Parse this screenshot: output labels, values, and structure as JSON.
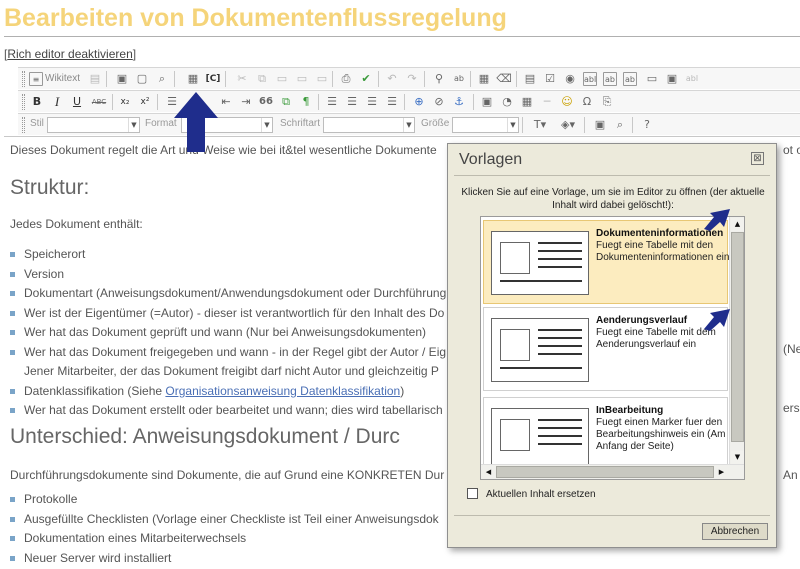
{
  "page": {
    "title": "Bearbeiten von Dokumentenflussregelung",
    "rich_editor_link_open": "[",
    "rich_editor_link": "Rich editor deaktivieren",
    "rich_editor_link_close": "]"
  },
  "toolbar": {
    "wikitext": "Wikitext",
    "style_label": "Stil",
    "format_label": "Format",
    "font_label": "Schriftart",
    "size_label": "Größe",
    "bold": "B",
    "italic": "I",
    "underline": "U",
    "strike": "ABC",
    "subscript": "x₂",
    "superscript": "x²",
    "quote": "66",
    "icons": [
      "source-icon",
      "templates-icon",
      "save-icon",
      "new-page-icon",
      "preview-icon",
      "cut-icon",
      "copy-icon",
      "paste-icon",
      "print-icon",
      "spellcheck-icon",
      "undo-icon",
      "redo-icon",
      "find-icon",
      "replace-icon",
      "table-icon",
      "smiley-icon",
      "anchor-icon",
      "image-icon",
      "link-icon",
      "help-icon"
    ]
  },
  "content": {
    "intro": "Dieses Dokument regelt die Art und Weise wie bei it&tel wesentliche Dokumente",
    "intro_tail": "ot o",
    "heading1": "Struktur:",
    "lead1": "Jedes Dokument enthält:",
    "list1": [
      "Speicherort",
      "Version",
      "Dokumentart (Anweisungsdokument/Anwendungsdokument oder Durchführung",
      "Wer ist der Eigentümer (=Autor) - dieser ist verantwortlich für den Inhalt des Do",
      "Wer hat das Dokument geprüft und wann (Nur bei Anweisungsdokumenten)",
      "Wer hat das Dokument freigegeben und wann - in der Regel gibt der Autor / Eig"
    ],
    "list1_cont": "Jener Mitarbeiter, der das Dokument freigibt darf nicht Autor und gleichzeitig P",
    "list1_klass_prefix": "Datenklassifikation (Siehe ",
    "list1_klass_link": "Organisationsanweisung Datenklassifikation",
    "list1_klass_suffix": ")",
    "list1_last": "Wer hat das Dokument erstellt oder bearbeitet und wann; dies wird tabellarisch",
    "right_frag_1": "(Ne",
    "right_frag_2": "ers u",
    "heading2": "Unterschied: Anweisungsdokument / Durc",
    "lead2": "Durchführungsdokumente sind Dokumente, die auf Grund eine KONKRETEN Dur",
    "lead2_tail": "An",
    "list2": [
      "Protokolle",
      "Ausgefüllte Checklisten (Vorlage einer Checkliste ist Teil einer Anweisungsdok",
      "Dokumentation eines Mitarbeiterwechsels",
      "Neuer Server wird installiert"
    ]
  },
  "dialog": {
    "title": "Vorlagen",
    "close": "⊠",
    "description": "Klicken Sie auf eine Vorlage, um sie im Editor zu öffnen (der aktuelle Inhalt wird dabei gelöscht!):",
    "templates": [
      {
        "name": "Dokumenteninformationen",
        "desc": "Fuegt eine Tabelle mit den Dokumenteninformationen ein",
        "selected": true
      },
      {
        "name": "Aenderungsverlauf",
        "desc": "Fuegt eine Tabelle mit dem Aenderungsverlauf ein",
        "selected": false
      },
      {
        "name": "InBearbeitung",
        "desc": "Fuegt einen Marker fuer den Bearbeitungshinweis ein (Am Anfang der Seite)",
        "selected": false
      }
    ],
    "checkbox_label": "Aktuellen Inhalt ersetzen",
    "checkbox_checked": false,
    "cancel": "Abbrechen"
  },
  "colors": {
    "title": "#f5d47a",
    "arrow": "#1f2d8c",
    "selected_template": "#fcecbf",
    "dialog_bg": "#eceadb",
    "link": "#4a6fb5"
  }
}
